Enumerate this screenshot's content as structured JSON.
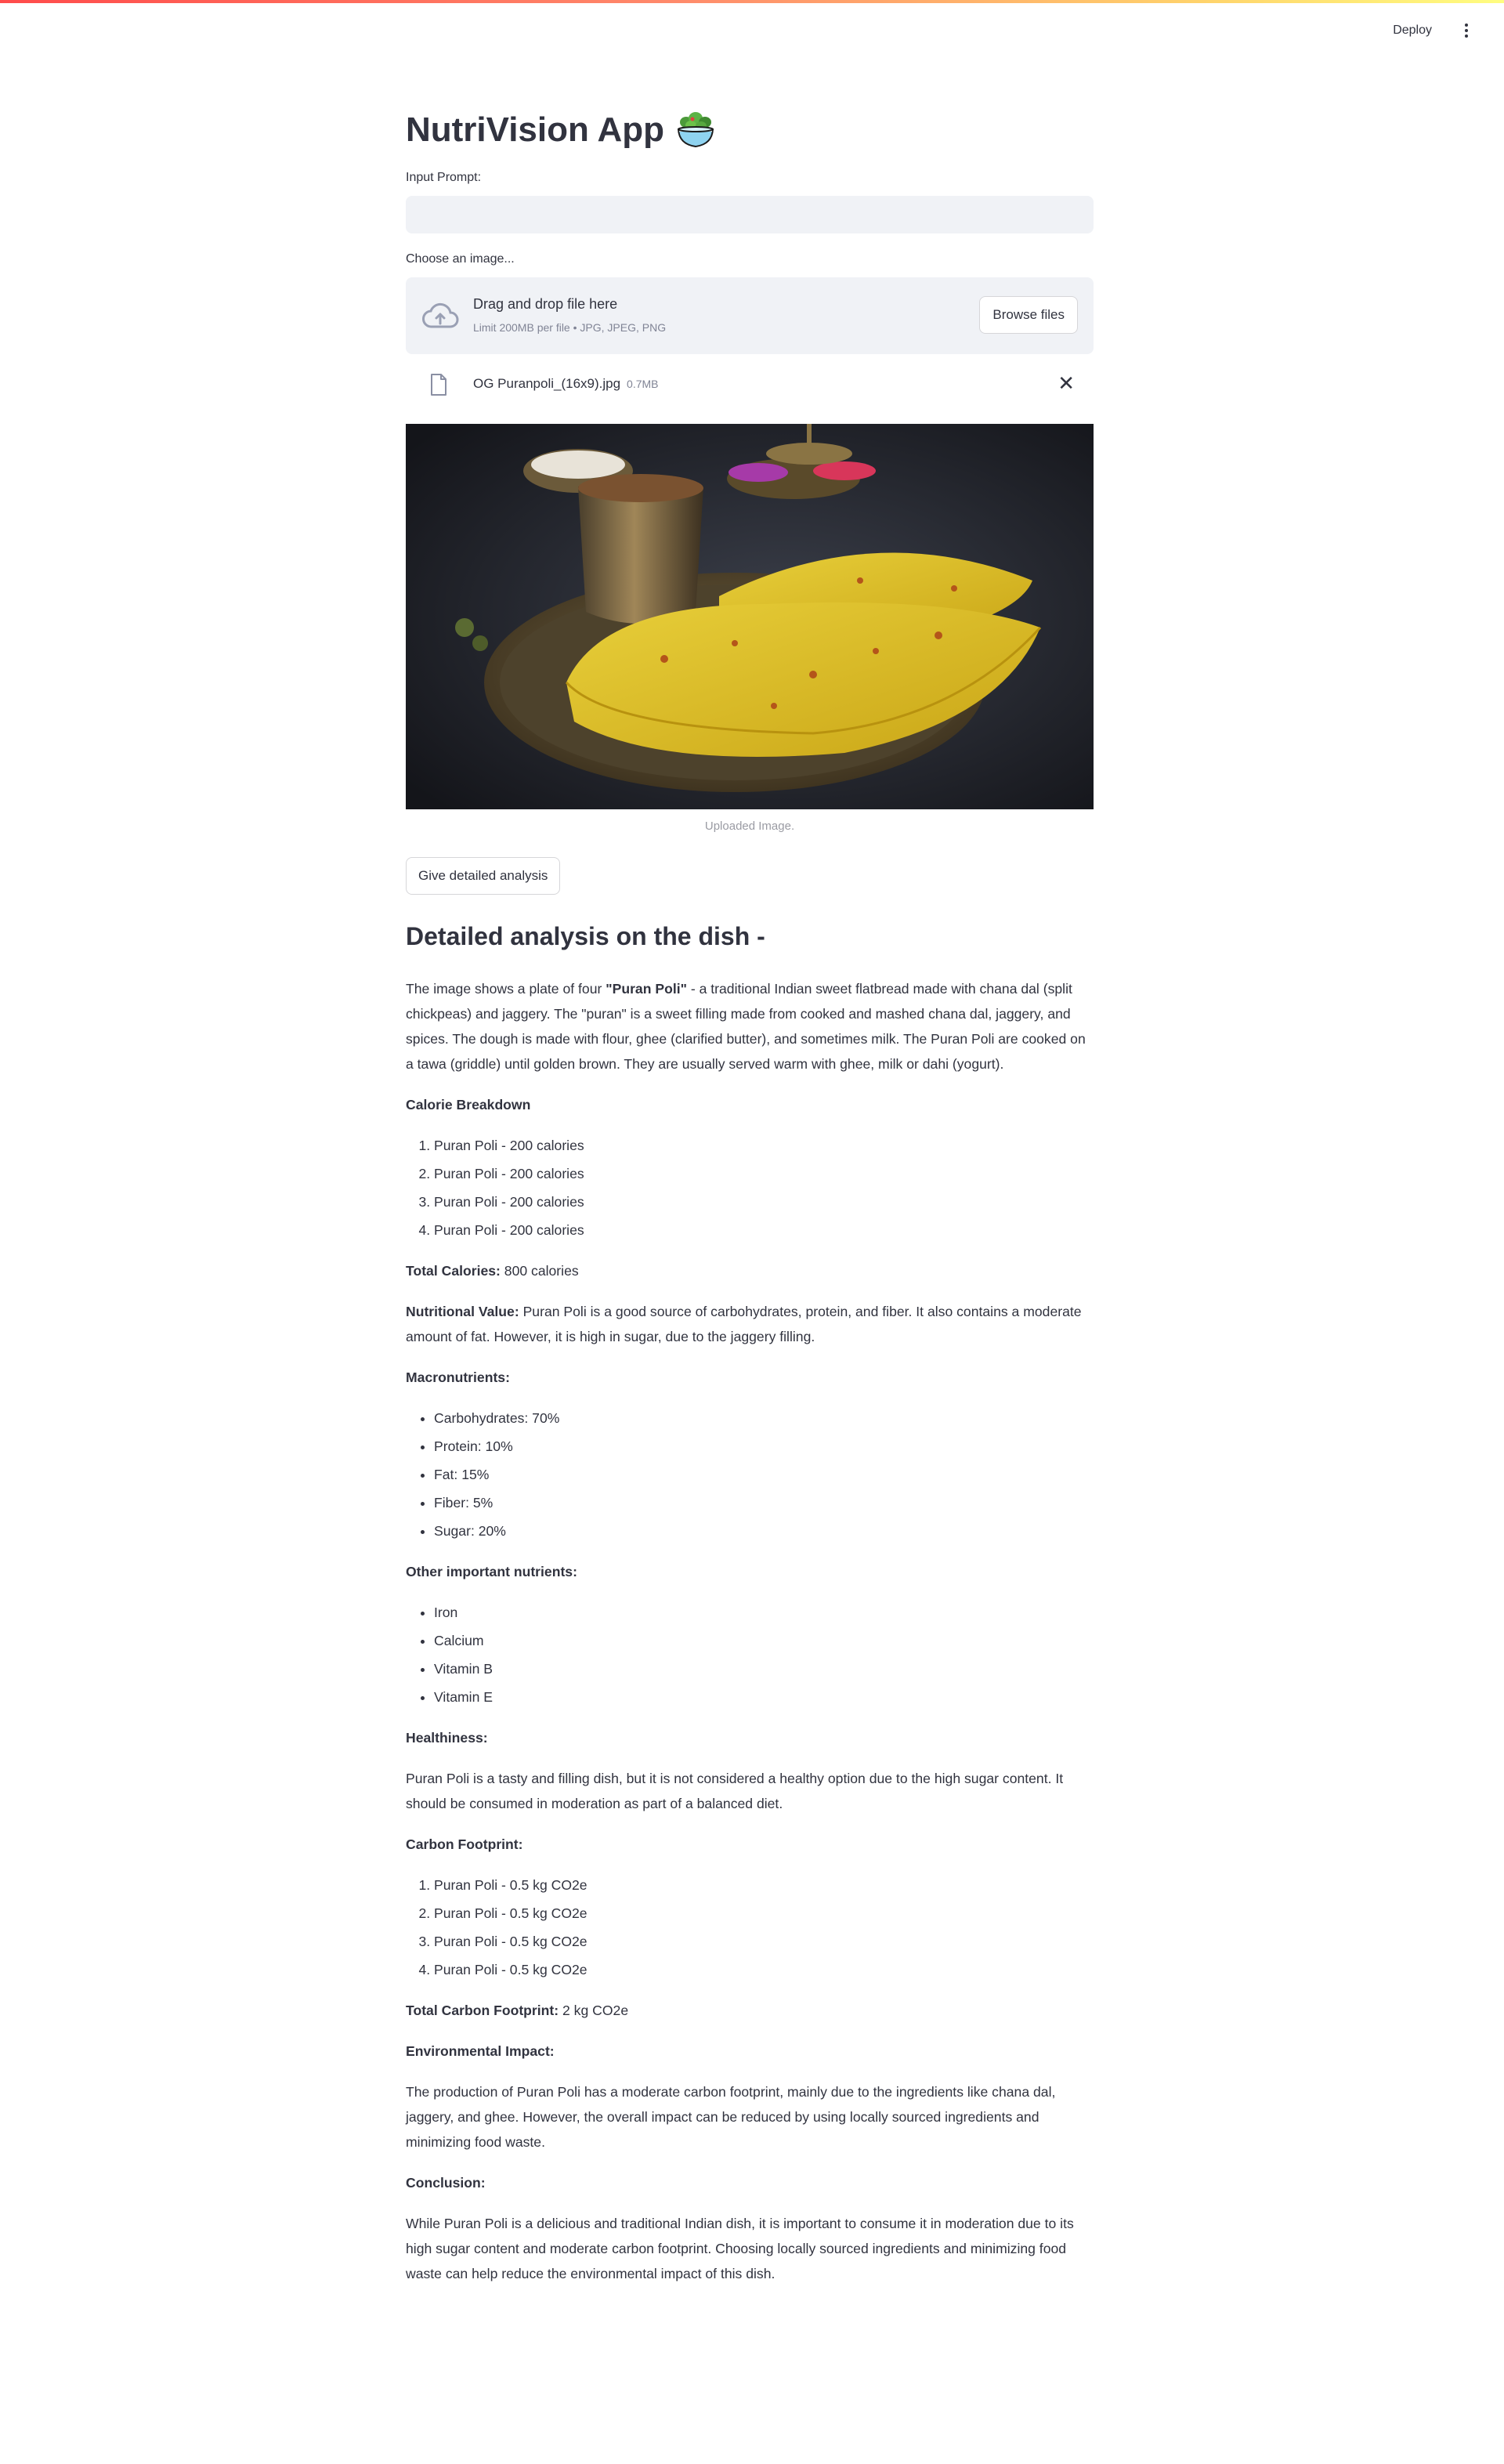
{
  "header": {
    "deploy_label": "Deploy",
    "menu_icon": "kebab-menu-icon"
  },
  "app": {
    "title": "NutriVision App",
    "title_icon": "salad-bowl-icon"
  },
  "prompt": {
    "label": "Input Prompt:",
    "value": "",
    "placeholder": ""
  },
  "uploader": {
    "label": "Choose an image...",
    "drag_text": "Drag and drop file here",
    "limit_text": "Limit 200MB per file • JPG, JPEG, PNG",
    "browse_label": "Browse files",
    "file_name": "OG Puranpoli_(16x9).jpg",
    "file_size": "0.7MB"
  },
  "image": {
    "caption": "Uploaded Image.",
    "subject": "puran-poli-plate-photo"
  },
  "action": {
    "analyze_label": "Give detailed analysis"
  },
  "analysis": {
    "heading": "Detailed analysis on the dish -",
    "intro_before": "The image shows a plate of four ",
    "intro_bold": "\"Puran Poli\"",
    "intro_after": " - a traditional Indian sweet flatbread made with chana dal (split chickpeas) and jaggery. The \"puran\" is a sweet filling made from cooked and mashed chana dal, jaggery, and spices. The dough is made with flour, ghee (clarified butter), and sometimes milk. The Puran Poli are cooked on a tawa (griddle) until golden brown. They are usually served warm with ghee, milk or dahi (yogurt).",
    "calorie_heading": "Calorie Breakdown",
    "calories": [
      "Puran Poli - 200 calories",
      "Puran Poli - 200 calories",
      "Puran Poli - 200 calories",
      "Puran Poli - 200 calories"
    ],
    "total_calories_label": "Total Calories:",
    "total_calories_value": " 800 calories",
    "nutritional_label": "Nutritional Value:",
    "nutritional_text": " Puran Poli is a good source of carbohydrates, protein, and fiber. It also contains a moderate amount of fat. However, it is high in sugar, due to the jaggery filling.",
    "macro_heading": "Macronutrients:",
    "macros": [
      "Carbohydrates: 70%",
      "Protein: 10%",
      "Fat: 15%",
      "Fiber: 5%",
      "Sugar: 20%"
    ],
    "other_heading": "Other important nutrients:",
    "other": [
      "Iron",
      "Calcium",
      "Vitamin B",
      "Vitamin E"
    ],
    "health_heading": "Healthiness:",
    "health_text": "Puran Poli is a tasty and filling dish, but it is not considered a healthy option due to the high sugar content. It should be consumed in moderation as part of a balanced diet.",
    "carbon_heading": "Carbon Footprint:",
    "carbon": [
      "Puran Poli - 0.5 kg CO2e",
      "Puran Poli - 0.5 kg CO2e",
      "Puran Poli - 0.5 kg CO2e",
      "Puran Poli - 0.5 kg CO2e"
    ],
    "total_carbon_label": "Total Carbon Footprint:",
    "total_carbon_value": " 2 kg CO2e",
    "env_heading": "Environmental Impact:",
    "env_text": "The production of Puran Poli has a moderate carbon footprint, mainly due to the ingredients like chana dal, jaggery, and ghee. However, the overall impact can be reduced by using locally sourced ingredients and minimizing food waste.",
    "conclusion_heading": "Conclusion:",
    "conclusion_text": "While Puran Poli is a delicious and traditional Indian dish, it is important to consume it in moderation due to its high sugar content and moderate carbon footprint. Choosing locally sourced ingredients and minimizing food waste can help reduce the environmental impact of this dish."
  }
}
